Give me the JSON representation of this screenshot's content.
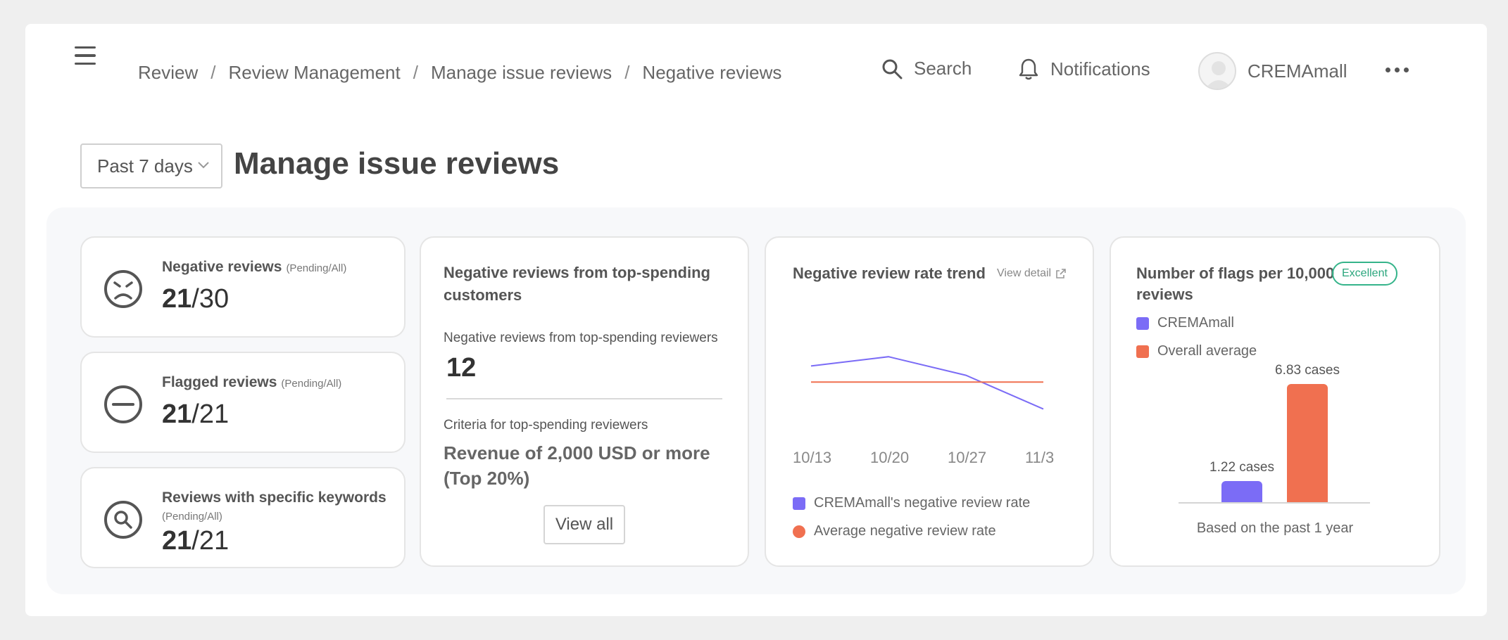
{
  "header": {
    "breadcrumb": [
      "Review",
      "Review Management",
      "Manage issue reviews",
      "Negative reviews"
    ],
    "search_label": "Search",
    "notifications_label": "Notifications",
    "user_name": "CREMAmall"
  },
  "toolbar": {
    "period_value": "Past 7 days",
    "page_title": "Manage issue reviews"
  },
  "stats": [
    {
      "label": "Negative reviews",
      "sub": "(Pending/All)",
      "value_bold": "21",
      "value_rest": "/30",
      "icon": "sad-face-icon"
    },
    {
      "label": "Flagged reviews",
      "sub": "(Pending/All)",
      "value_bold": "21",
      "value_rest": "/21",
      "icon": "minus-circle-icon"
    },
    {
      "label": "Reviews with specific keywords",
      "sub": "(Pending/All)",
      "value_bold": "21",
      "value_rest": "/21",
      "icon": "search-circle-icon"
    }
  ],
  "top_spenders": {
    "title": "Negative reviews from top-spending customers",
    "count_label": "Negative reviews from top-spending reviewers",
    "count_value": "12",
    "criteria_label": "Criteria for top-spending reviewers",
    "criteria_value": "Revenue of 2,000 USD or more (Top 20%)",
    "button_label": "View all"
  },
  "trend": {
    "title": "Negative review rate trend",
    "link_label": "View detail",
    "legend": [
      "CREMAmall's negative review rate",
      "Average negative review rate"
    ],
    "colors": {
      "mall": "#7b6cf6",
      "average": "#f07050"
    }
  },
  "flags": {
    "title": "Number of flags per 10,000 reviews",
    "badge": "Excellent",
    "legend": [
      "CREMAmall",
      "Overall average"
    ],
    "footnote": "Based on the past 1 year"
  },
  "chart_data": [
    {
      "type": "line",
      "title": "Negative review rate trend",
      "categories": [
        "10/13",
        "10/20",
        "10/27",
        "11/3"
      ],
      "series": [
        {
          "name": "CREMAmall's negative review rate",
          "values": [
            0.73,
            0.84,
            0.62,
            0.22
          ]
        },
        {
          "name": "Average negative review rate",
          "values": [
            0.54,
            0.54,
            0.54,
            0.54
          ]
        }
      ],
      "ylim": [
        0,
        1
      ],
      "legend": "bottom"
    },
    {
      "type": "bar",
      "title": "Number of flags per 10,000 reviews",
      "categories": [
        "CREMAmall",
        "Overall average"
      ],
      "values": [
        1.22,
        6.83
      ],
      "labels": [
        "1.22 cases",
        "6.83 cases"
      ],
      "colors": [
        "#7b6cf6",
        "#f07050"
      ],
      "ylim": [
        0,
        6.83
      ],
      "legend": "top-left"
    }
  ]
}
